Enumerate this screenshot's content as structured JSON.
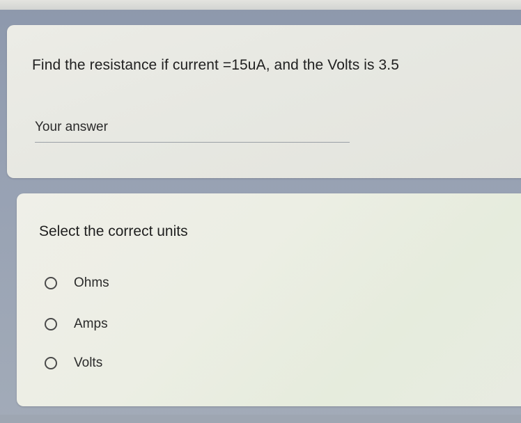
{
  "question1": {
    "title": "Find the resistance if current =15uA, and the Volts is 3.5",
    "placeholder": "Your answer"
  },
  "question2": {
    "title": "Select the correct units",
    "options": [
      {
        "label": "Ohms",
        "selected": false
      },
      {
        "label": "Amps",
        "selected": false
      },
      {
        "label": "Volts",
        "selected": false
      }
    ]
  },
  "colors": {
    "background": "#97a1b3",
    "card": "#e9e9e3",
    "text": "#1f1f1f",
    "radio_border": "#4a4a4a",
    "underline": "#9aa0a6"
  }
}
